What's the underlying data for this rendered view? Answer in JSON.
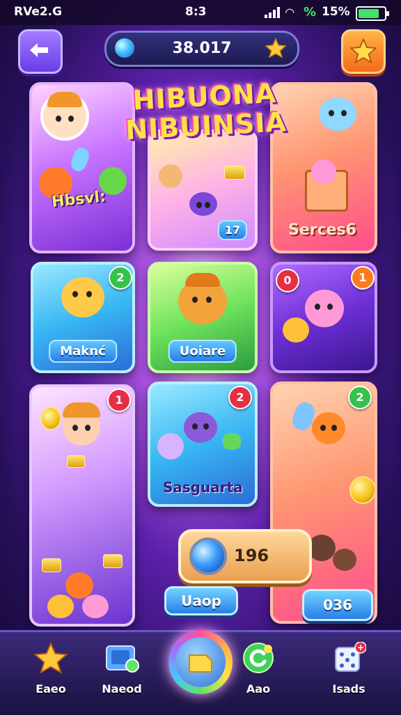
{
  "status_bar": {
    "left": "RVe2.G",
    "time": "8:3",
    "battery_pct": "15%",
    "battery_level": 0.9,
    "signal_icon": "signal-icon",
    "wifi_icon": "wifi-icon"
  },
  "header": {
    "currency_value": "38.017",
    "gem_icon": "gem-icon",
    "star_icon": "star-icon",
    "back_icon": "back-arrow-icon"
  },
  "logo": {
    "line1": "HIBUONA",
    "line2": "NIBUINSIA"
  },
  "cards": [
    {
      "id": "c1",
      "label": "Hbsvl:",
      "badge": ""
    },
    {
      "id": "c2",
      "label": "17",
      "badge": ""
    },
    {
      "id": "c3",
      "label": "Serces6",
      "badge": ""
    },
    {
      "id": "c4",
      "label": "Maknć",
      "badge": "2"
    },
    {
      "id": "c5",
      "label": "Uoiare",
      "badge": ""
    },
    {
      "id": "c6",
      "label": "",
      "badge": "1",
      "badge2": "0"
    },
    {
      "id": "c7",
      "label": "",
      "badge": "1"
    },
    {
      "id": "c8",
      "label": "Sasguarta",
      "badge": "2"
    },
    {
      "id": "c9",
      "label": "",
      "badge": "2"
    }
  ],
  "info_pill": {
    "value": "196"
  },
  "buttons": {
    "left_bottom": "Uaop",
    "right_bottom": "036"
  },
  "nav": [
    {
      "label": "Eaeo",
      "icon": "star-icon"
    },
    {
      "label": "Naeod",
      "icon": "photo-icon"
    },
    {
      "label": "",
      "icon": "play-icon"
    },
    {
      "label": "Aao",
      "icon": "refresh-icon"
    },
    {
      "label": "Isads",
      "icon": "dice-icon",
      "badge": "+"
    }
  ],
  "colors": {
    "accent": "#6a3de6",
    "gold": "#f6c21a",
    "badge_red": "#e62e44",
    "badge_green": "#35c24a"
  }
}
